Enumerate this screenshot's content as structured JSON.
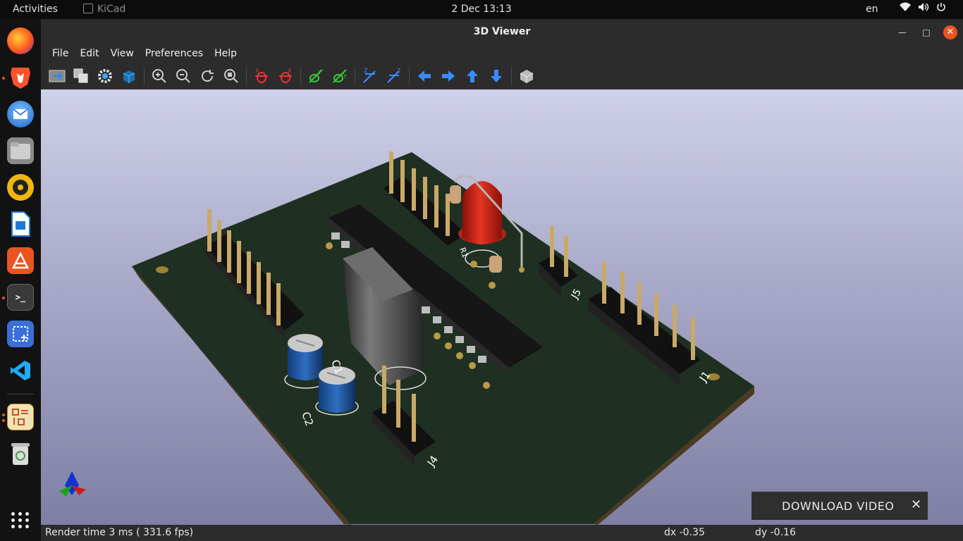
{
  "topbar": {
    "activities": "Activities",
    "app_name": "KiCad",
    "clock": "2 Dec  13:13",
    "lang": "en"
  },
  "dock": {
    "items": [
      "firefox-icon",
      "brave-icon",
      "thunderbird-icon",
      "files-icon",
      "rhythmbox-icon",
      "writer-icon",
      "software-icon",
      "terminal-icon",
      "screenshot-icon",
      "vscode-icon",
      "kicad-icon",
      "trash-icon"
    ]
  },
  "window": {
    "title": "3D Viewer"
  },
  "menu": {
    "file": "File",
    "edit": "Edit",
    "view": "View",
    "preferences": "Preferences",
    "help": "Help"
  },
  "labels": {
    "c1": "C1",
    "c2": "C2",
    "j1": "J1",
    "j4": "J4",
    "j5": "J5",
    "r1": "R1"
  },
  "overlay": {
    "download": "DOWNLOAD VIDEO",
    "close": "✕"
  },
  "status": {
    "render": "Render time 3 ms ( 331.6 fps)",
    "dx": "dx -0.35",
    "dy": "dy -0.16"
  },
  "colors": {
    "pcb": "#1f3023",
    "led": "#d6261c",
    "accent": "#e95420"
  }
}
